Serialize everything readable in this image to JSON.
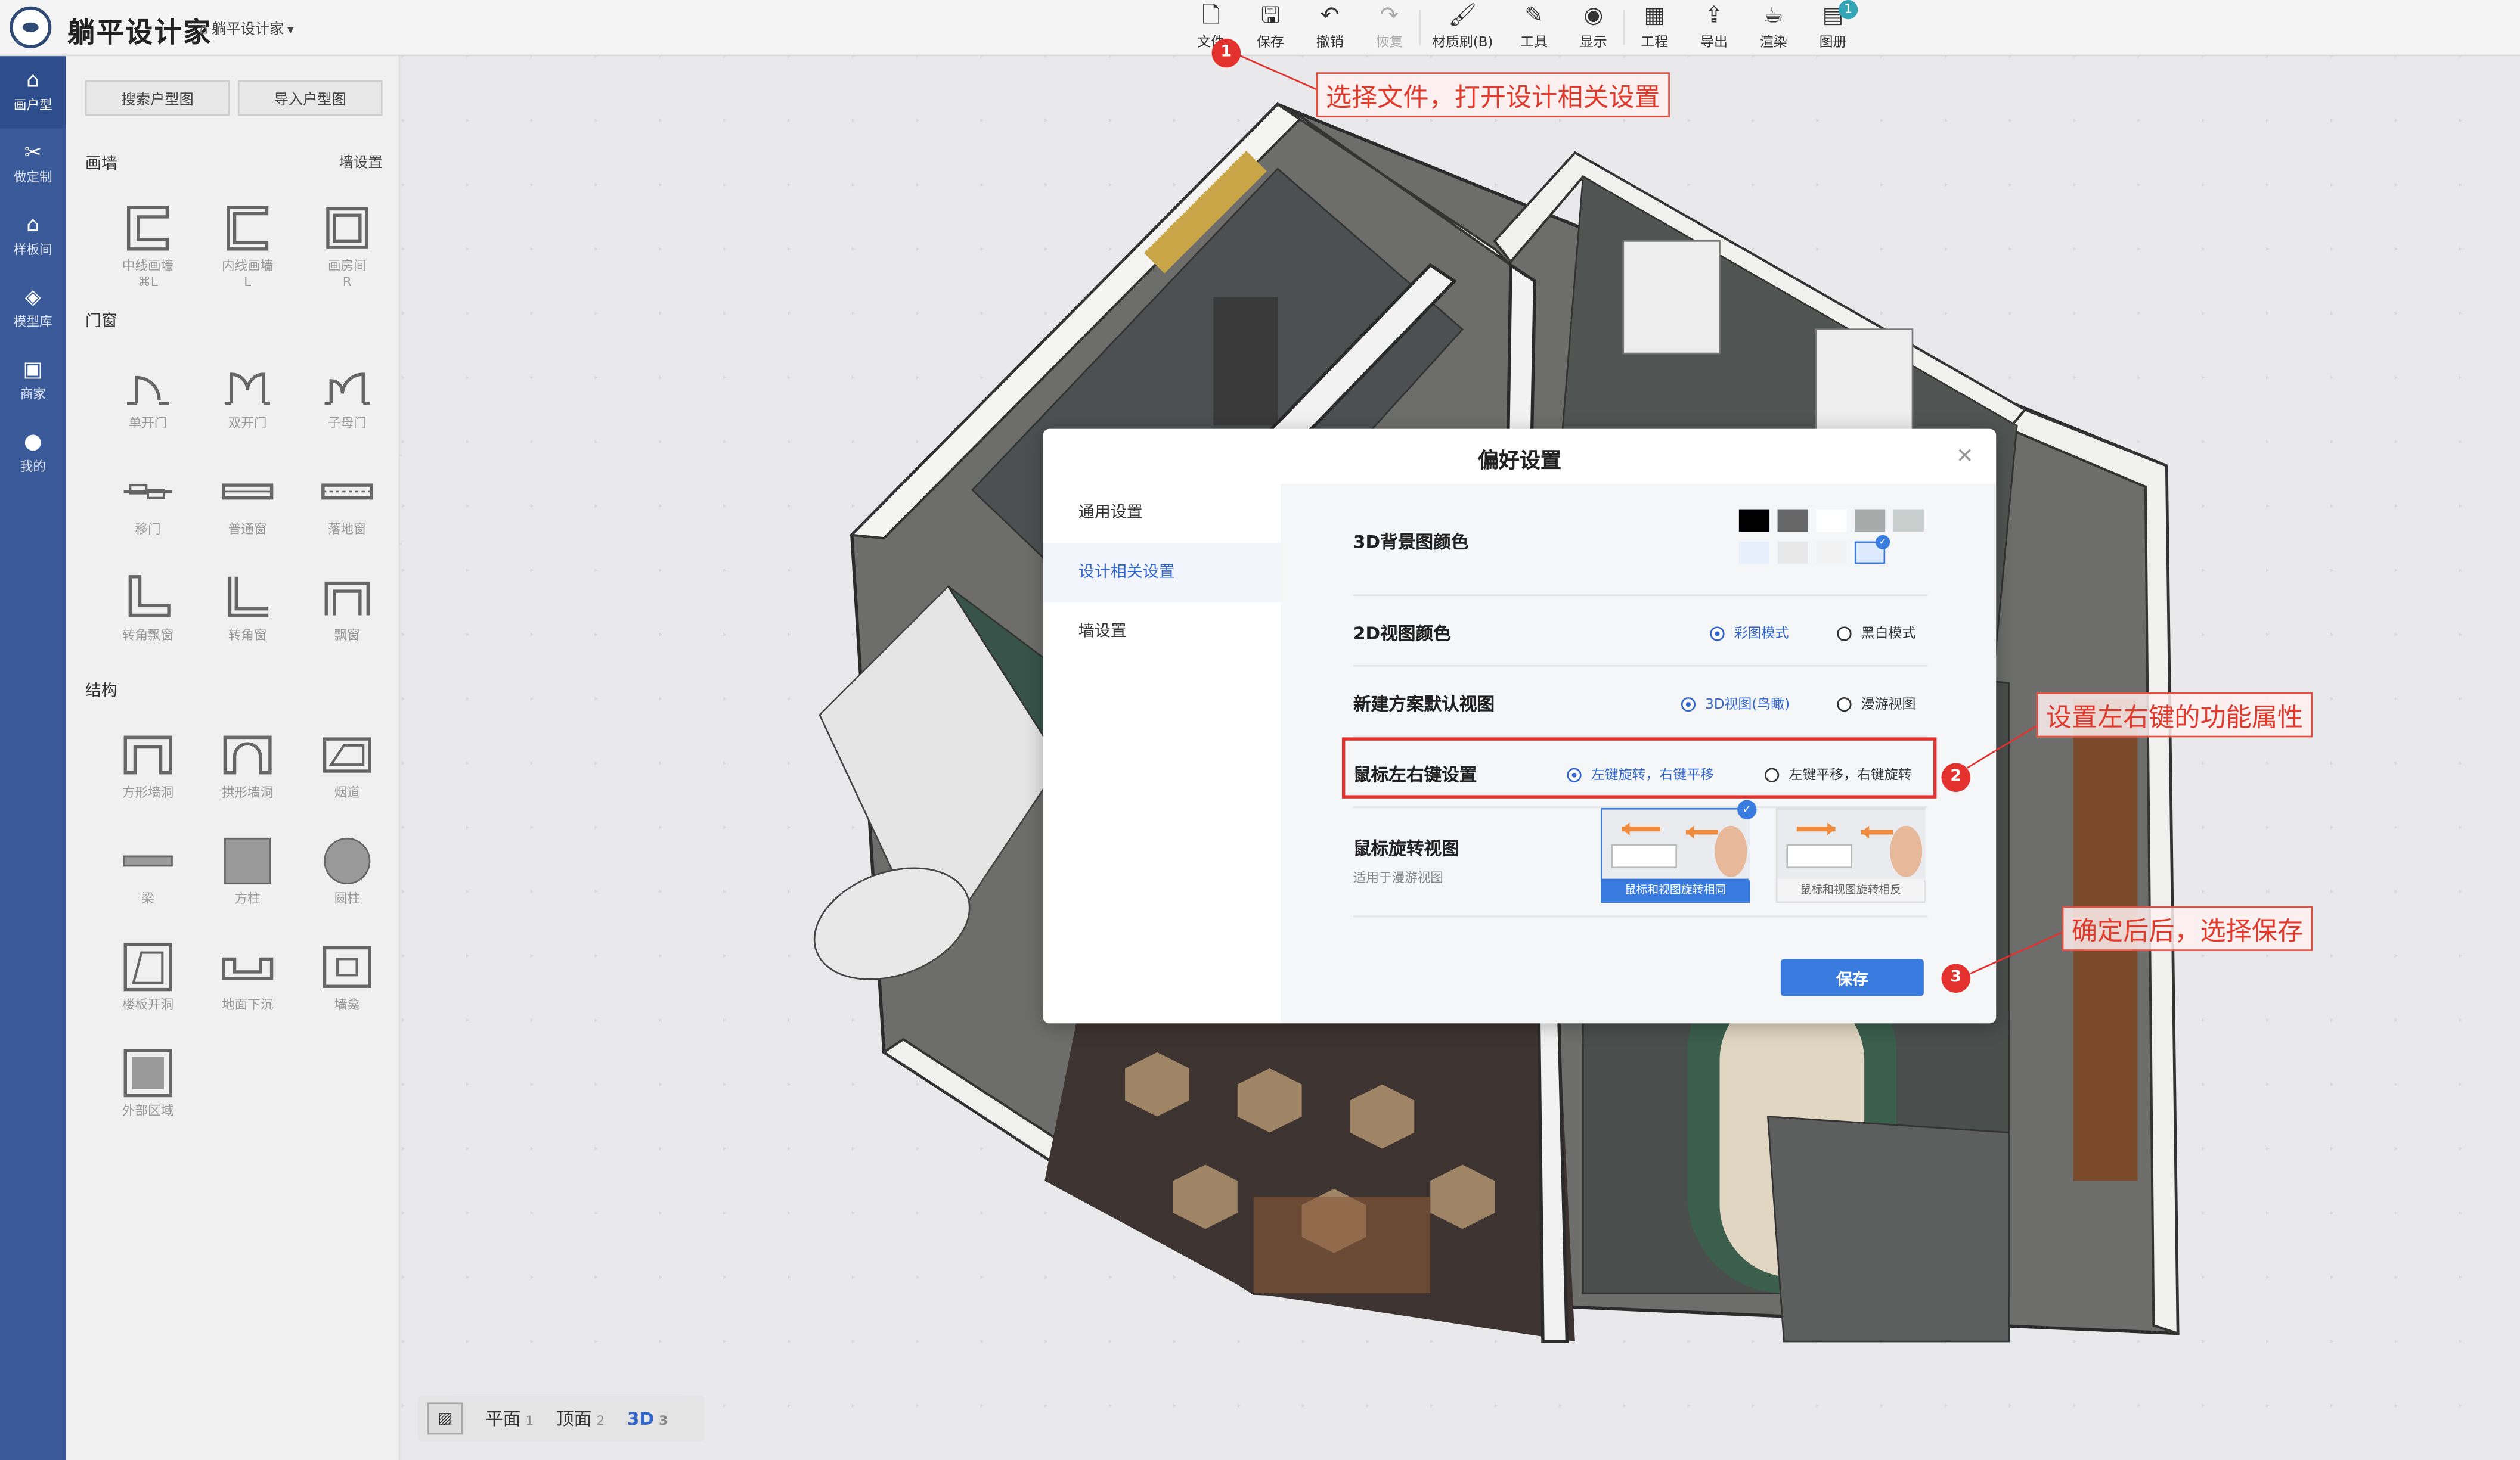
{
  "app": {
    "brand": "躺平设计家",
    "project": "躺平设计家"
  },
  "toolbar": [
    {
      "label": "文件",
      "icon": "file-icon"
    },
    {
      "label": "保存",
      "icon": "save-icon"
    },
    {
      "label": "撤销",
      "icon": "undo-icon"
    },
    {
      "label": "恢复",
      "icon": "redo-icon",
      "disabled": true
    },
    {
      "label": "材质刷(B)",
      "icon": "brush-icon"
    },
    {
      "label": "工具",
      "icon": "tools-icon"
    },
    {
      "label": "显示",
      "icon": "eye-icon"
    },
    {
      "label": "工程",
      "icon": "project-icon"
    },
    {
      "label": "导出",
      "icon": "export-icon"
    },
    {
      "label": "渲染",
      "icon": "render-icon"
    },
    {
      "label": "图册",
      "icon": "album-icon",
      "badge": "1"
    }
  ],
  "leftnav": [
    {
      "label": "画户型",
      "icon": "floorplan-icon",
      "active": true
    },
    {
      "label": "做定制",
      "icon": "custom-icon"
    },
    {
      "label": "样板间",
      "icon": "home-icon"
    },
    {
      "label": "模型库",
      "icon": "cube-icon"
    },
    {
      "label": "商家",
      "icon": "shop-icon"
    },
    {
      "label": "我的",
      "icon": "user-icon"
    }
  ],
  "panel": {
    "search_btn": "搜索户型图",
    "import_btn": "导入户型图",
    "sections": [
      {
        "title": "画墙",
        "link": "墙设置",
        "items": [
          {
            "label": "中线画墙",
            "sub": "⌘L",
            "shape": "wall-center"
          },
          {
            "label": "内线画墙",
            "sub": "L",
            "shape": "wall-inner"
          },
          {
            "label": "画房间",
            "sub": "R",
            "shape": "room"
          }
        ]
      },
      {
        "title": "门窗",
        "link": "",
        "items": [
          {
            "label": "单开门",
            "shape": "door-single"
          },
          {
            "label": "双开门",
            "shape": "door-double"
          },
          {
            "label": "子母门",
            "shape": "door-mother"
          },
          {
            "label": "移门",
            "shape": "door-slide"
          },
          {
            "label": "普通窗",
            "shape": "window"
          },
          {
            "label": "落地窗",
            "shape": "window-floor"
          },
          {
            "label": "转角飘窗",
            "shape": "bay-corner"
          },
          {
            "label": "转角窗",
            "shape": "window-corner"
          },
          {
            "label": "飘窗",
            "shape": "bay"
          }
        ]
      },
      {
        "title": "结构",
        "link": "",
        "items": [
          {
            "label": "方形墙洞",
            "shape": "hole-square"
          },
          {
            "label": "拱形墙洞",
            "shape": "hole-arch"
          },
          {
            "label": "烟道",
            "shape": "flue"
          },
          {
            "label": "梁",
            "shape": "beam"
          },
          {
            "label": "方柱",
            "shape": "pillar-square"
          },
          {
            "label": "圆柱",
            "shape": "pillar-round"
          },
          {
            "label": "楼板开洞",
            "shape": "slab-hole"
          },
          {
            "label": "地面下沉",
            "shape": "floor-sink"
          },
          {
            "label": "墙龛",
            "shape": "niche"
          },
          {
            "label": "外部区域",
            "shape": "outer"
          }
        ]
      }
    ]
  },
  "viewbar": {
    "options": [
      {
        "label": "平面",
        "num": "1"
      },
      {
        "label": "顶面",
        "num": "2"
      },
      {
        "label": "3D",
        "num": "3",
        "active": true
      }
    ]
  },
  "modal": {
    "title": "偏好设置",
    "side": [
      "通用设置",
      "设计相关设置",
      "墙设置"
    ],
    "active_side": 1,
    "rows": {
      "bg_color": {
        "label": "3D背景图颜色",
        "swatches": [
          "#000000",
          "#666666",
          "#ffffff",
          "#a6aaa9",
          "#c7cfcc",
          "#e6effb",
          "#e8e8e8",
          "#f2f2f2",
          "#ddeafd"
        ],
        "selected": 8
      },
      "view2d": {
        "label": "2D视图颜色",
        "options": [
          "彩图模式",
          "黑白模式"
        ],
        "selected": 0
      },
      "default_view": {
        "label": "新建方案默认视图",
        "options": [
          "3D视图(鸟瞰)",
          "漫游视图"
        ],
        "selected": 0
      },
      "mouse_keys": {
        "label": "鼠标左右键设置",
        "options": [
          "左键旋转，右键平移",
          "左键平移，右键旋转"
        ],
        "selected": 0
      },
      "mouse_rotate": {
        "label": "鼠标旋转视图",
        "sub": "适用于漫游视图",
        "options": [
          "鼠标和视图旋转相同",
          "鼠标和视图旋转相反"
        ],
        "selected": 0
      }
    },
    "save_label": "保存"
  },
  "annotations": [
    {
      "num": "1",
      "text": "选择文件，打开设计相关设置"
    },
    {
      "num": "2",
      "text": "设置左右键的功能属性"
    },
    {
      "num": "3",
      "text": "确定后后，选择保存"
    }
  ]
}
